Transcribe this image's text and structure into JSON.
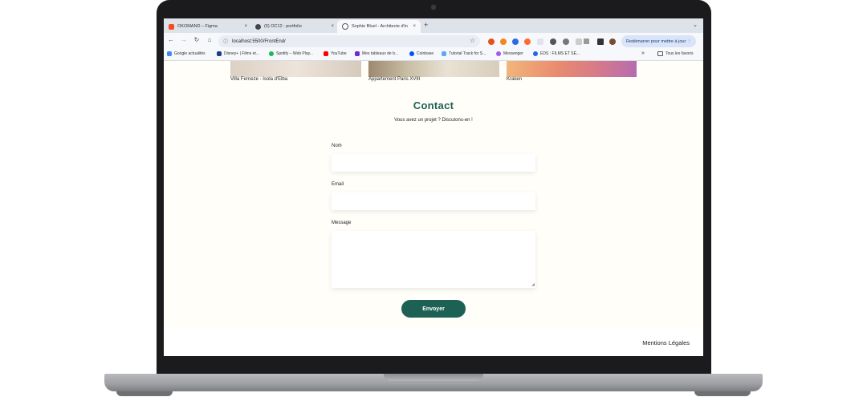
{
  "browser": {
    "tabs": [
      {
        "title": "OKOMAND – Figma",
        "close": "×",
        "color": "#f24e1e"
      },
      {
        "title": "(5) OC12 : portfolio",
        "close": "×",
        "color": "#444"
      },
      {
        "title": "Sophie Bluel - Architecte d'in",
        "close": "×",
        "color": "#555"
      }
    ],
    "new_tab": "+",
    "tab_menu": "⌄",
    "url": "localhost:5500/FrontEnd/",
    "relaunch_label": "Redémarrer pour mettre à jour ⋮",
    "bookmarks": [
      {
        "label": "Google actualités",
        "color": "#4285f4"
      },
      {
        "label": "Disney+ | Films et...",
        "color": "#1e3a8a"
      },
      {
        "label": "Spotify – Web Play...",
        "color": "#1db954"
      },
      {
        "label": "YouTube",
        "color": "#ff0000"
      },
      {
        "label": "Mes tableaux de b...",
        "color": "#6d28d9"
      },
      {
        "label": "Coinbase",
        "color": "#0052ff"
      },
      {
        "label": "Tutorial Track for S...",
        "color": "#60a5fa"
      },
      {
        "label": "Messenger",
        "color": "#a855f7"
      },
      {
        "label": "EDS : FILMS ET SÉ...",
        "color": "#2563eb"
      }
    ],
    "bookmarks_more": "»",
    "all_bookmarks": "Tous les favoris"
  },
  "gallery": {
    "captions": [
      "Villa Ferneze - Isola d'Elba",
      "Appartement Paris XVIII",
      "Kraken"
    ]
  },
  "contact": {
    "title": "Contact",
    "subtitle": "Vous avez un projet ? Discutons-en !",
    "name_label": "Nom",
    "email_label": "Email",
    "message_label": "Message",
    "submit_label": "Envoyer"
  },
  "footer": {
    "legal": "Mentions Légales"
  },
  "colors": {
    "brand": "#1d6154",
    "page_bg": "#fffef8"
  }
}
